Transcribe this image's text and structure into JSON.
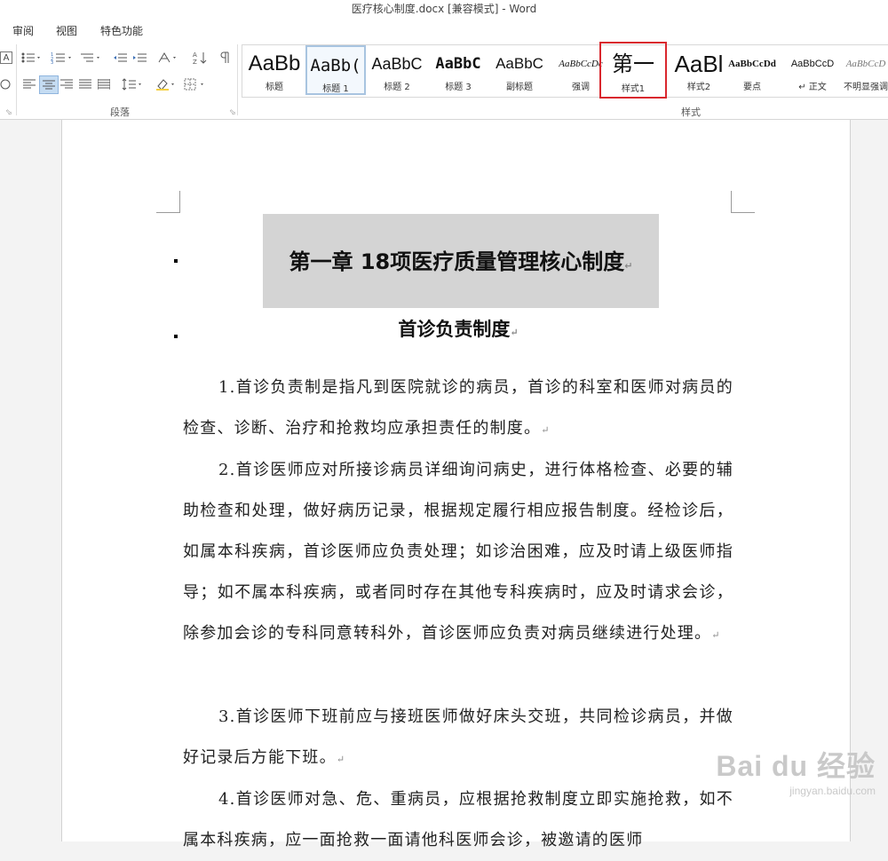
{
  "window": {
    "title": "医疗核心制度.docx [兼容模式] - Word"
  },
  "tabs": [
    "审阅",
    "视图",
    "特色功能"
  ],
  "ribbon": {
    "paragraph_group_label": "段落",
    "styles_group_label": "样式",
    "styles": [
      {
        "preview": "AaBb",
        "name": "标题",
        "state": "normal"
      },
      {
        "preview": "AaBb(",
        "name": "标题 1",
        "state": "selected"
      },
      {
        "preview": "AaBbC",
        "name": "标题 2",
        "state": "normal"
      },
      {
        "preview": "AaBbC",
        "name": "标题 3",
        "state": "normal"
      },
      {
        "preview": "AaBbC",
        "name": "副标题",
        "state": "normal"
      },
      {
        "preview": "AaBbCcDc",
        "name": "强调",
        "state": "normal"
      },
      {
        "preview": "第一",
        "name": "样式1",
        "state": "highlighted"
      },
      {
        "preview": "AaBl",
        "name": "样式2",
        "state": "normal"
      },
      {
        "preview": "AaBbCcDd",
        "name": "要点",
        "state": "normal"
      },
      {
        "preview": "AaBbCcD",
        "name": "↵ 正文",
        "state": "normal"
      },
      {
        "preview": "AaBbCcD",
        "name": "不明显强调",
        "state": "normal"
      }
    ],
    "highlight_color": "#d9272e"
  },
  "document": {
    "chapter_title": "第一章   18项医疗质量管理核心制度",
    "section_title": "首诊负责制度",
    "paragraph_mark": "↵",
    "paragraphs": [
      "1.首诊负责制是指凡到医院就诊的病员，首诊的科室和医师对病员的检查、诊断、治疗和抢救均应承担责任的制度。",
      "2.首诊医师应对所接诊病员详细询问病史，进行体格检查、必要的辅助检查和处理，做好病历记录，根据规定履行相应报告制度。经检诊后，如属本科疾病，首诊医师应负责处理；如诊治困难，应及时请上级医师指导；如不属本科疾病，或者同时存在其他专科疾病时，应及时请求会诊，除参加会诊的专科同意转科外，首诊医师应负责对病员继续进行处理。",
      "3.首诊医师下班前应与接班医师做好床头交班，共同检诊病员，并做好记录后方能下班。",
      "4.首诊医师对急、危、重病员，应根据抢救制度立即实施抢救，如不属本科疾病，应一面抢救一面请他科医师会诊，被邀请的医师"
    ]
  },
  "watermark": {
    "brand": "Bai du 经验",
    "url": "jingyan.baidu.com"
  }
}
